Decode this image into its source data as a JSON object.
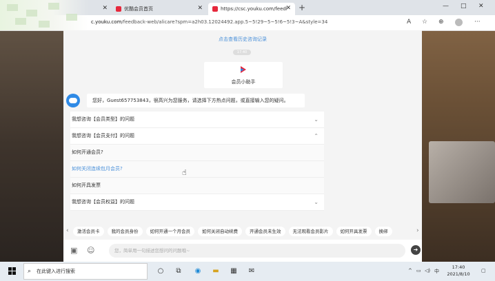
{
  "browser": {
    "tabs": [
      {
        "label": "",
        "active": false
      },
      {
        "label": "优酷会员首页",
        "active": false
      },
      {
        "label": "https://csc.youku.com/feedback",
        "active": true
      }
    ],
    "new_tab": "+",
    "window_controls": [
      "—",
      "□",
      "✕"
    ],
    "url_domain": "c.youku.com",
    "url_path": "/feedback-web/alicare?spm=a2h03.12024492.app.5~5!29~5~5!6~5!3~A&style=34"
  },
  "chat": {
    "history_link": "点击查看历史咨询记录",
    "time_pill": "17:40",
    "assistant_name": "会员小助手",
    "greeting": "您好，Guest657753843，很高兴为您服务，请选择下方热点问题，或直接输入您的疑问。",
    "faq": [
      {
        "label": "我想咨询【会员类型】的问题",
        "type": "category",
        "chevron": "⌄"
      },
      {
        "label": "我想咨询【会员支付】的问题",
        "type": "category",
        "chevron": "⌃"
      },
      {
        "label": "如何开通会员?",
        "type": "sub",
        "chevron": ""
      },
      {
        "label": "如何关闭连续包月会员?",
        "type": "link",
        "chevron": ""
      },
      {
        "label": "如何开具发票",
        "type": "sub",
        "chevron": ""
      },
      {
        "label": "我想咨询【会员权益】的问题",
        "type": "category",
        "chevron": "⌄"
      }
    ],
    "quick_chips": [
      "激活会员卡",
      "我的会员身份",
      "如何开通一个月会员",
      "如何关闭自动续费",
      "开通会员未生效",
      "无法观看会员影片",
      "如何开具发票",
      "换绑"
    ],
    "input_placeholder": "您，简单用一句描述您想问的问题哦~"
  },
  "taskbar": {
    "search_placeholder": "在此键入进行搜索",
    "ime": "中",
    "time": "17:40",
    "date": "2021/8/10"
  },
  "colors": {
    "link": "#4a90d9",
    "bot_avatar": "#2f8ae6",
    "youku_red": "#e6283c"
  }
}
